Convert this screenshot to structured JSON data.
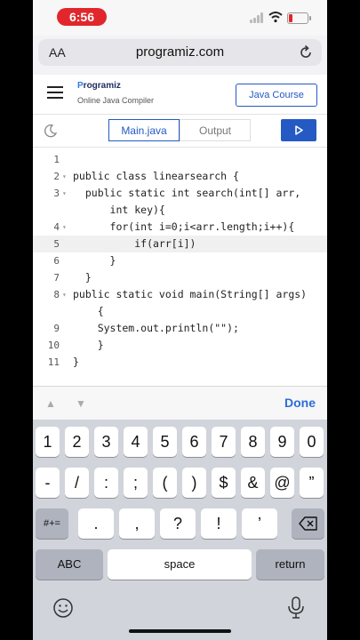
{
  "status_bar": {
    "time": "6:56"
  },
  "browser": {
    "text_size_label": "AA",
    "url": "programiz.com"
  },
  "site": {
    "logo_initial": "P",
    "logo_rest": "rogramiz",
    "subtitle": "Online Java Compiler",
    "course_button": "Java Course"
  },
  "tabs": {
    "main": "Main.java",
    "output": "Output"
  },
  "editor": {
    "lines": [
      {
        "num": "1",
        "fold": false,
        "text": ""
      },
      {
        "num": "2",
        "fold": true,
        "text": "public class linearsearch {"
      },
      {
        "num": "3",
        "fold": true,
        "text": "  public static int search(int[] arr,"
      },
      {
        "num": "",
        "fold": false,
        "text": "      int key){"
      },
      {
        "num": "4",
        "fold": true,
        "text": "      for(int i=0;i<arr.length;i++){"
      },
      {
        "num": "5",
        "fold": false,
        "text": "          if(arr[i])"
      },
      {
        "num": "6",
        "fold": false,
        "text": "      }"
      },
      {
        "num": "7",
        "fold": false,
        "text": "  }"
      },
      {
        "num": "8",
        "fold": true,
        "text": "public static void main(String[] args)"
      },
      {
        "num": "",
        "fold": false,
        "text": "    {"
      },
      {
        "num": "9",
        "fold": false,
        "text": "    System.out.println(\"\");"
      },
      {
        "num": "10",
        "fold": false,
        "text": "    }"
      },
      {
        "num": "11",
        "fold": false,
        "text": "}"
      }
    ],
    "active_line_index": 5
  },
  "keyboard": {
    "done_label": "Done",
    "row1": [
      "1",
      "2",
      "3",
      "4",
      "5",
      "6",
      "7",
      "8",
      "9",
      "0"
    ],
    "row2": [
      "-",
      "/",
      ":",
      ";",
      "(",
      ")",
      "$",
      "&",
      "@",
      "”"
    ],
    "row3_left": "#+=",
    "row3": [
      ".",
      ",",
      "?",
      "!",
      "’"
    ],
    "abc": "ABC",
    "space": "space",
    "return": "return"
  },
  "icons": [
    "hamburger-icon",
    "moon-icon",
    "play-icon",
    "reload-icon",
    "backspace-icon",
    "emoji-icon",
    "microphone-icon",
    "chevron-up-icon",
    "chevron-down-icon"
  ],
  "colors": {
    "accent": "#2559c4",
    "time_pill": "#e1272b",
    "done": "#2b6ed6"
  }
}
